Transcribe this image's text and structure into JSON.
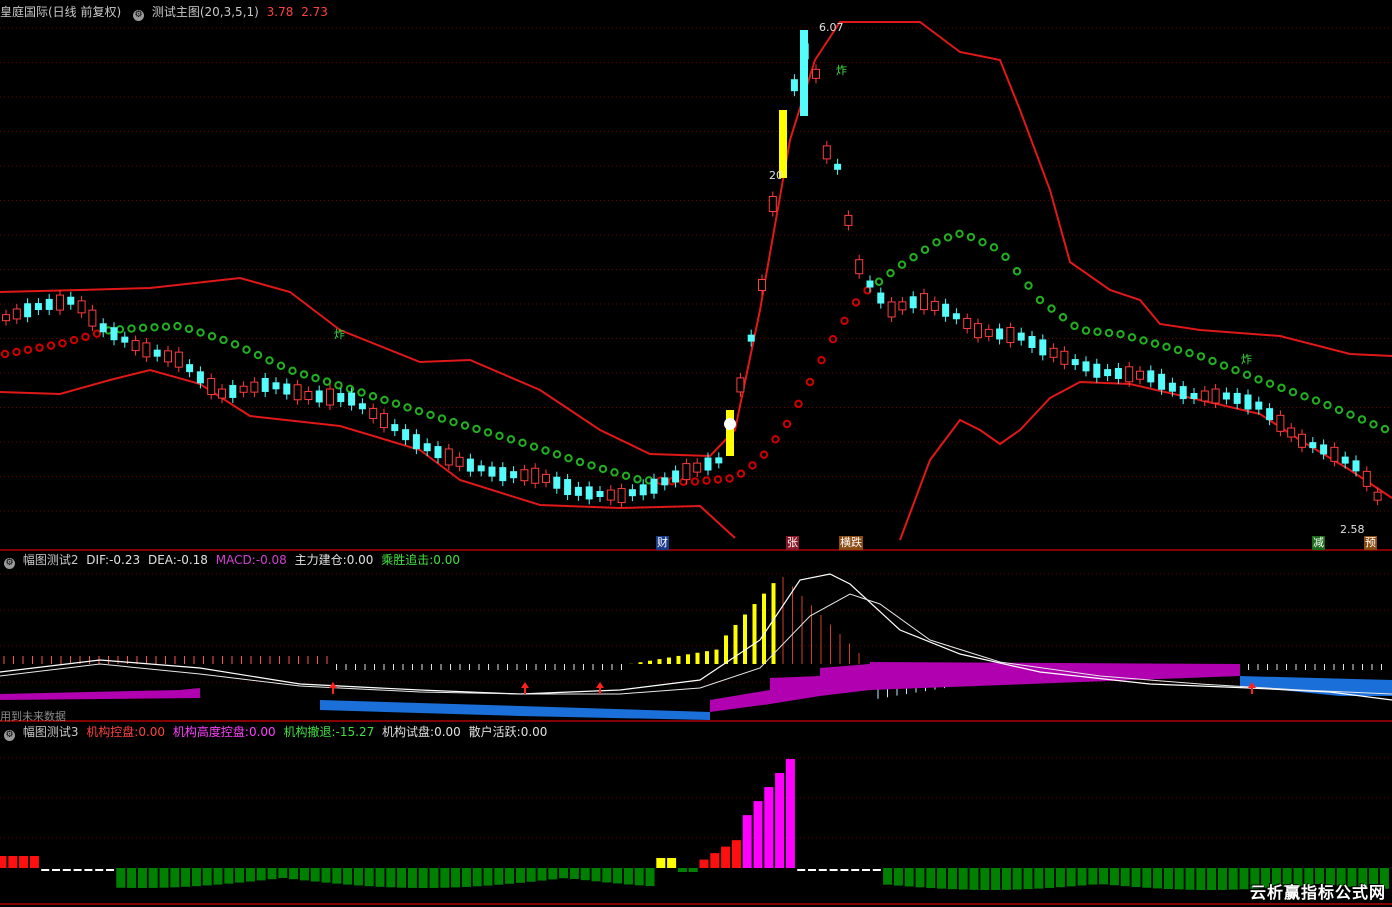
{
  "main_header": {
    "instrument": "皇庭国际(日线 前复权)",
    "indicator": "测试主图(20,3,5,1)",
    "value1": "3.78",
    "value2": "2.73"
  },
  "price_labels": {
    "high": "6.07",
    "low": "2.58",
    "mark_20": "20"
  },
  "zha_label": "炸",
  "signal_tags": {
    "cai": "财",
    "zhang": "张",
    "hengdie": "横跌",
    "jian": "减",
    "yu": "预"
  },
  "sub1_header": {
    "name": "幅图测试2",
    "dif_label": "DIF:",
    "dif_value": "-0.23",
    "dea_label": "DEA:",
    "dea_value": "-0.18",
    "macd_label": "MACD:",
    "macd_value": "-0.08",
    "zljc_label": "主力建仓:",
    "zljc_value": "0.00",
    "ssz_label": "乘胜追击:",
    "ssz_value": "0.00"
  },
  "sub1_note": "用到未来数据",
  "sub2_header": {
    "name": "幅图测试3",
    "jgkp_label": "机构控盘:",
    "jgkp_value": "0.00",
    "jggd_label": "机构高度控盘:",
    "jggd_value": "0.00",
    "jgct_label": "机构撤退:",
    "jgct_value": "-15.27",
    "jgsp_label": "机构试盘:",
    "jgsp_value": "0.00",
    "shhy_label": "散户活跃:",
    "shhy_value": "0.00"
  },
  "watermark": "云析赢指标公式网",
  "colors": {
    "up": "#ff3c3c",
    "down": "#54fcfc",
    "dot_green": "#1aa01a",
    "dot_red": "#b00000",
    "macd_purple": "#b000b0",
    "macd_blue": "#1a6fd8",
    "bar_green": "#008000",
    "bar_red": "#ff1010",
    "bar_magenta": "#ff00ff",
    "bar_yellow": "#ffff00"
  }
}
